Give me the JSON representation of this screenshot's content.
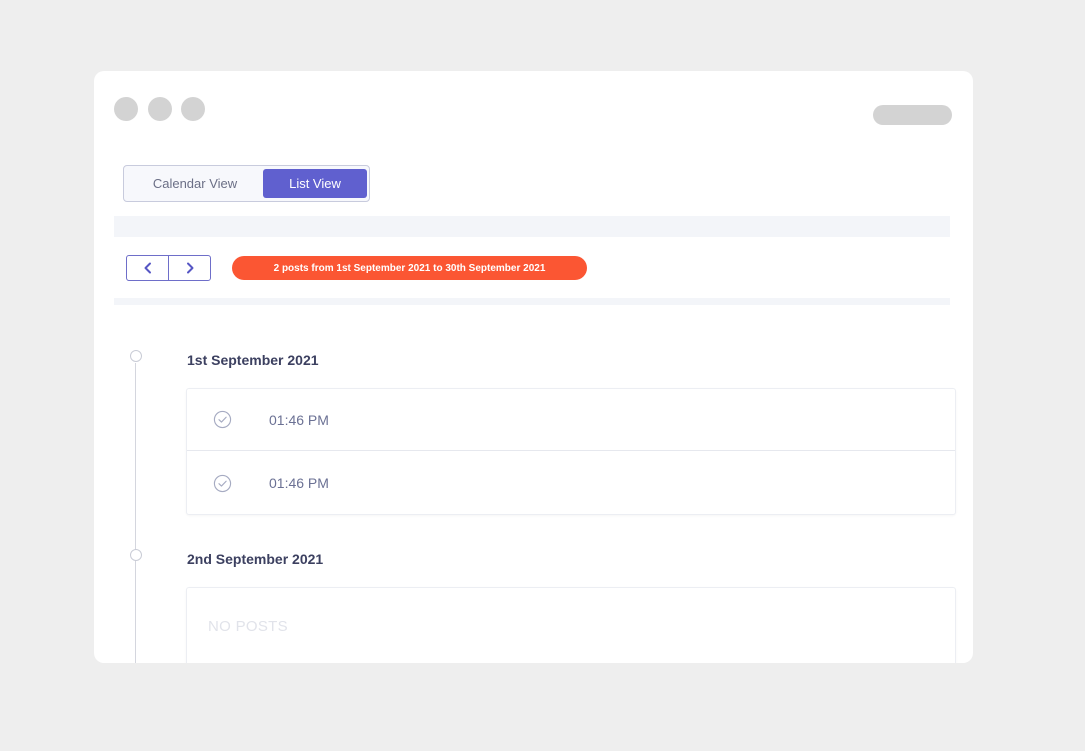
{
  "view_toggle": {
    "calendar_label": "Calendar View",
    "list_label": "List View",
    "active": "List View"
  },
  "navigation": {
    "prev_icon": "chevron-left-icon",
    "next_icon": "chevron-right-icon"
  },
  "range_badge": {
    "text": "2 posts from 1st September 2021 to 30th September 2021"
  },
  "days": [
    {
      "date": "1st September 2021",
      "posts": [
        {
          "time": "01:46 PM",
          "status_icon": "check-circle-icon"
        },
        {
          "time": "01:46 PM",
          "status_icon": "check-circle-icon"
        }
      ]
    },
    {
      "date": "2nd September 2021",
      "empty_text": "NO POSTS"
    }
  ],
  "colors": {
    "background": "#eeeeee",
    "accent": "#6060cf",
    "badge": "#fb5633",
    "placeholder": "#d3d3d3"
  }
}
